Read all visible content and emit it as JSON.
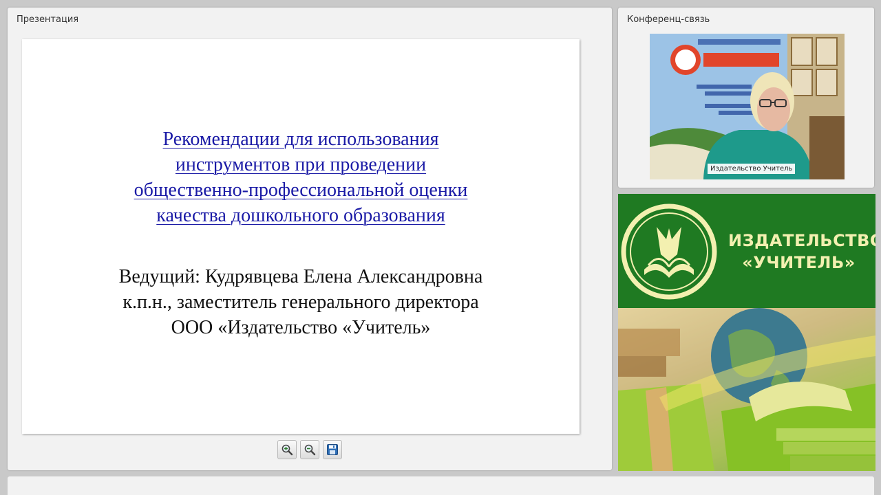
{
  "presentation": {
    "panel_title": "Презентация",
    "slide": {
      "title_lines": [
        "Рекомендации для использования",
        "инструментов при проведении",
        "общественно-профессиональной оценки",
        "качества дошкольного образования"
      ],
      "presenter_lines": [
        "Ведущий: Кудрявцева Елена Александровна",
        "к.п.н., заместитель генерального директора",
        "ООО «Издательство «Учитель»"
      ]
    },
    "toolbar": {
      "zoom_in_icon": "zoom-in-icon",
      "zoom_out_icon": "zoom-out-icon",
      "save_icon": "save-icon"
    }
  },
  "conference": {
    "panel_title": "Конференц-связь",
    "video_caption": "Издательство Учитель"
  },
  "promo": {
    "brand_line1": "ИЗДАТЕЛЬСТВО",
    "brand_line2": "«УЧИТЕЛЬ»",
    "colors": {
      "green": "#1f7a22",
      "text": "#f3f0b0"
    }
  }
}
